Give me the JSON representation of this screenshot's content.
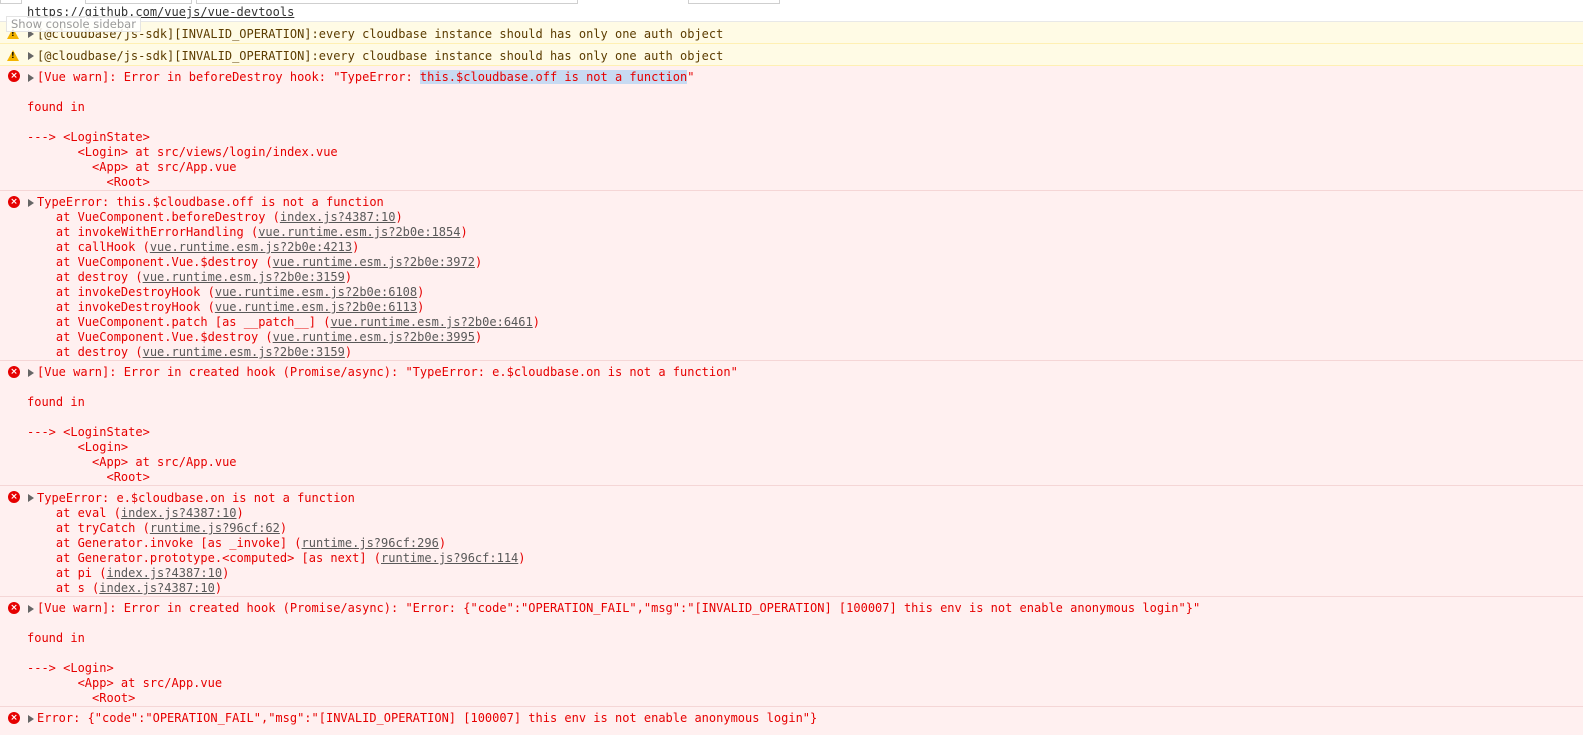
{
  "url_row": {
    "url": "https://github.com/vuejs/vue-devtools"
  },
  "sidebar_tip": "Show console sidebar",
  "warnings": [
    {
      "text": "[@cloudbase/js-sdk][INVALID_OPERATION]:every cloudbase instance should has only one auth object"
    },
    {
      "text": "[@cloudbase/js-sdk][INVALID_OPERATION]:every cloudbase instance should has only one auth object"
    }
  ],
  "err1": {
    "head": "[Vue warn]: Error in beforeDestroy hook: \"TypeError: ",
    "selected": "this.$cloudbase.off is not a function",
    "tail": "\"",
    "found": "found in",
    "tree": [
      "---> <LoginState>",
      "       <Login> at src/views/login/index.vue",
      "         <App> at src/App.vue",
      "           <Root>"
    ]
  },
  "err2": {
    "head": "TypeError: this.$cloudbase.off is not a function",
    "frames": [
      {
        "fn": "    at VueComponent.beforeDestroy (",
        "loc": "index.js?4387:10",
        "end": ")"
      },
      {
        "fn": "    at invokeWithErrorHandling (",
        "loc": "vue.runtime.esm.js?2b0e:1854",
        "end": ")"
      },
      {
        "fn": "    at callHook (",
        "loc": "vue.runtime.esm.js?2b0e:4213",
        "end": ")"
      },
      {
        "fn": "    at VueComponent.Vue.$destroy (",
        "loc": "vue.runtime.esm.js?2b0e:3972",
        "end": ")"
      },
      {
        "fn": "    at destroy (",
        "loc": "vue.runtime.esm.js?2b0e:3159",
        "end": ")"
      },
      {
        "fn": "    at invokeDestroyHook (",
        "loc": "vue.runtime.esm.js?2b0e:6108",
        "end": ")"
      },
      {
        "fn": "    at invokeDestroyHook (",
        "loc": "vue.runtime.esm.js?2b0e:6113",
        "end": ")"
      },
      {
        "fn": "    at VueComponent.patch [as __patch__] (",
        "loc": "vue.runtime.esm.js?2b0e:6461",
        "end": ")"
      },
      {
        "fn": "    at VueComponent.Vue.$destroy (",
        "loc": "vue.runtime.esm.js?2b0e:3995",
        "end": ")"
      },
      {
        "fn": "    at destroy (",
        "loc": "vue.runtime.esm.js?2b0e:3159",
        "end": ")"
      }
    ]
  },
  "err3": {
    "head": "[Vue warn]: Error in created hook (Promise/async): \"TypeError: e.$cloudbase.on is not a function\"",
    "found": "found in",
    "tree": [
      "---> <LoginState>",
      "       <Login>",
      "         <App> at src/App.vue",
      "           <Root>"
    ]
  },
  "err4": {
    "head": "TypeError: e.$cloudbase.on is not a function",
    "frames": [
      {
        "fn": "    at eval (",
        "loc": "index.js?4387:10",
        "end": ")"
      },
      {
        "fn": "    at tryCatch (",
        "loc": "runtime.js?96cf:62",
        "end": ")"
      },
      {
        "fn": "    at Generator.invoke [as _invoke] (",
        "loc": "runtime.js?96cf:296",
        "end": ")"
      },
      {
        "fn": "    at Generator.prototype.<computed> [as next] (",
        "loc": "runtime.js?96cf:114",
        "end": ")"
      },
      {
        "fn": "    at pi (",
        "loc": "index.js?4387:10",
        "end": ")"
      },
      {
        "fn": "    at s (",
        "loc": "index.js?4387:10",
        "end": ")"
      }
    ]
  },
  "err5": {
    "head": "[Vue warn]: Error in created hook (Promise/async): \"Error: {\"code\":\"OPERATION_FAIL\",\"msg\":\"[INVALID_OPERATION] [100007] this env is not enable anonymous login\"}\"",
    "found": "found in",
    "tree": [
      "---> <Login>",
      "       <App> at src/App.vue",
      "         <Root>"
    ]
  },
  "err6": {
    "head": "Error: {\"code\":\"OPERATION_FAIL\",\"msg\":\"[INVALID_OPERATION] [100007] this env is not enable anonymous login\"}"
  },
  "colors": {
    "error": "#e60000",
    "error_bg": "#fff0f0",
    "warn_bg": "#fffbe5",
    "selection": "#c8daf2"
  },
  "icons": {
    "error": "error-circle-icon",
    "warning": "warning-triangle-icon",
    "expand": "expand-triangle-icon"
  }
}
